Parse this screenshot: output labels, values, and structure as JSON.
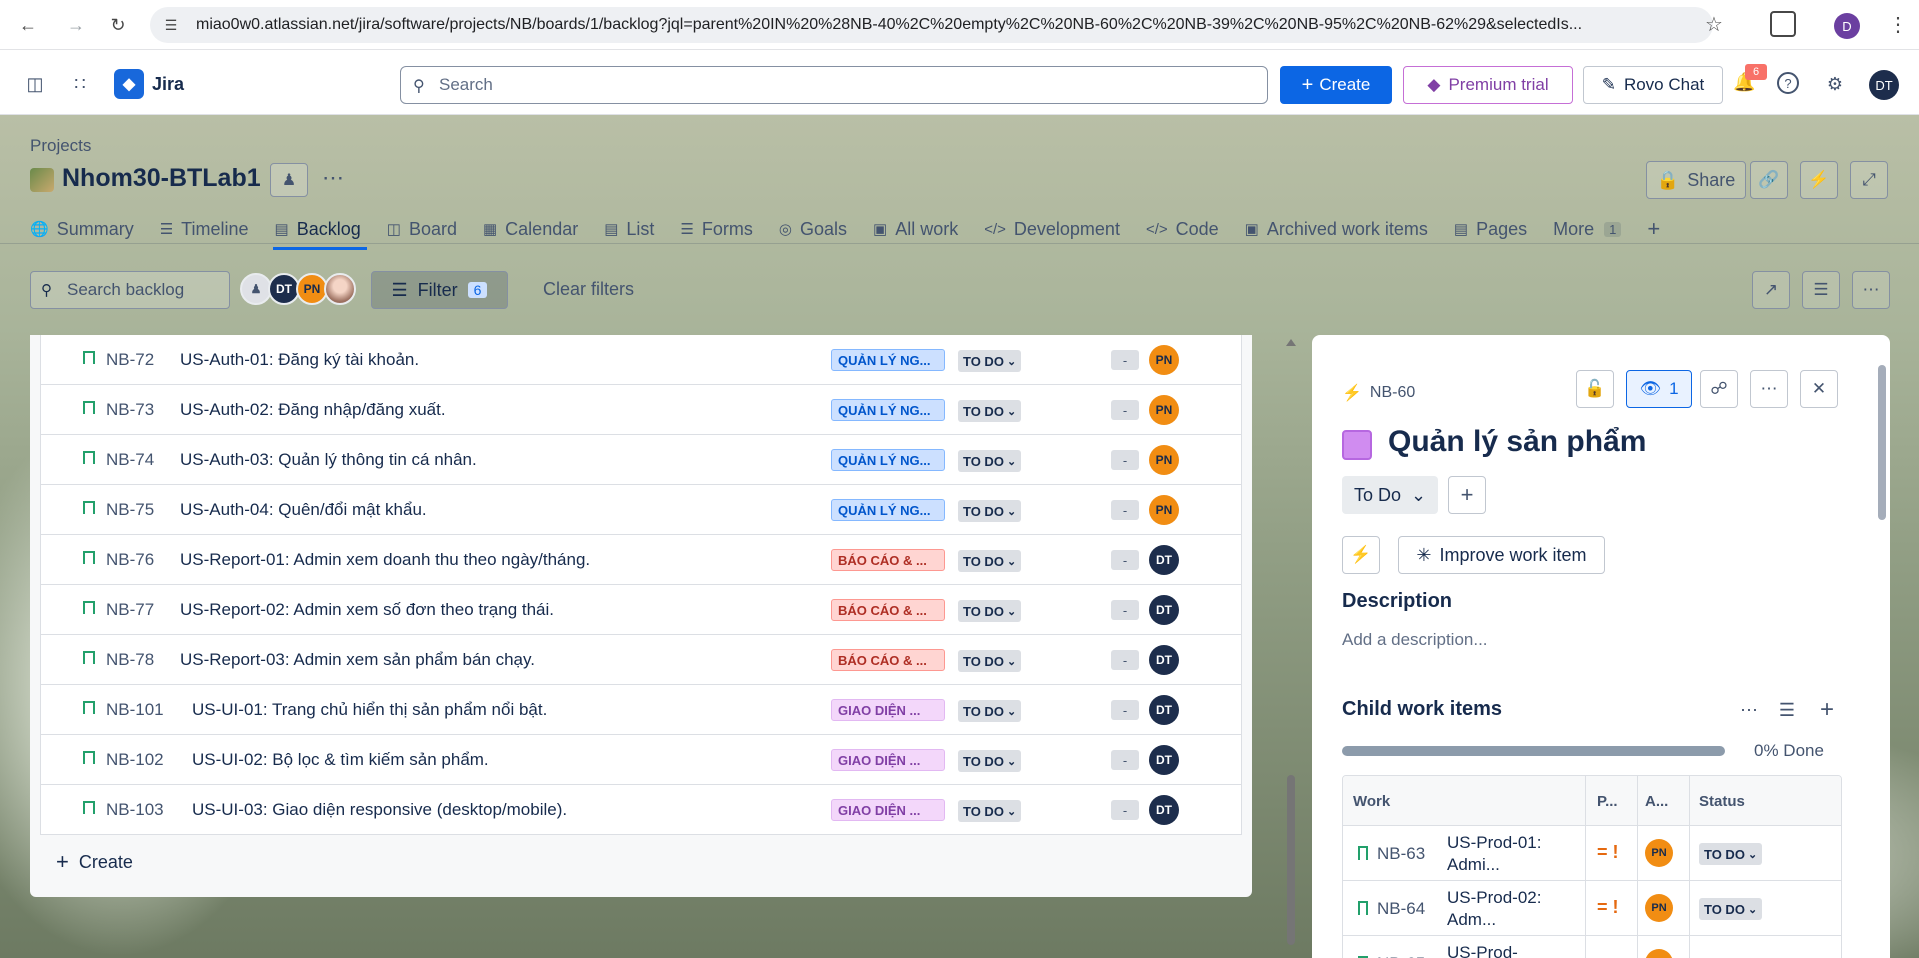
{
  "browser": {
    "url": "miao0w0.atlassian.net/jira/software/projects/NB/boards/1/backlog?jql=parent%20IN%20%28NB-40%2C%20empty%2C%20NB-60%2C%20NB-39%2C%20NB-95%2C%20NB-62%29&selectedIs...",
    "profile_initial": "D"
  },
  "topnav": {
    "app_name": "Jira",
    "search_placeholder": "Search",
    "create_label": "Create",
    "premium_label": "Premium trial",
    "rovo_label": "Rovo Chat",
    "notifications_count": "6",
    "user_initials": "DT"
  },
  "project": {
    "breadcrumb": "Projects",
    "name": "Nhom30-BTLab1",
    "share_label": "Share",
    "tabs": [
      {
        "label": "Summary",
        "icon": "globe-icon"
      },
      {
        "label": "Timeline",
        "icon": "timeline-icon"
      },
      {
        "label": "Backlog",
        "icon": "backlog-icon"
      },
      {
        "label": "Board",
        "icon": "board-icon"
      },
      {
        "label": "Calendar",
        "icon": "calendar-icon"
      },
      {
        "label": "List",
        "icon": "list-icon"
      },
      {
        "label": "Forms",
        "icon": "forms-icon"
      },
      {
        "label": "Goals",
        "icon": "goals-icon"
      },
      {
        "label": "All work",
        "icon": "all-work-icon"
      },
      {
        "label": "Development",
        "icon": "development-icon"
      },
      {
        "label": "Code",
        "icon": "code-icon"
      },
      {
        "label": "Archived work items",
        "icon": "archive-icon"
      },
      {
        "label": "Pages",
        "icon": "pages-icon"
      }
    ],
    "more_label": "More",
    "more_count": "1"
  },
  "toolbar": {
    "search_placeholder": "Search backlog",
    "avatars": [
      "DT",
      "PN"
    ],
    "filter_label": "Filter",
    "filter_count": "6",
    "clear_filters_label": "Clear filters"
  },
  "backlog": {
    "rows": [
      {
        "key": "NB-72",
        "summary": "US-Auth-01: Đăng ký tài khoản.",
        "epic": "QUẢN LÝ NG...",
        "epic_color": "blue",
        "status": "TO DO",
        "estimate": "-",
        "assignee": "PN"
      },
      {
        "key": "NB-73",
        "summary": "US-Auth-02: Đăng nhập/đăng xuất.",
        "epic": "QUẢN LÝ NG...",
        "epic_color": "blue",
        "status": "TO DO",
        "estimate": "-",
        "assignee": "PN"
      },
      {
        "key": "NB-74",
        "summary": "US-Auth-03: Quản lý thông tin cá nhân.",
        "epic": "QUẢN LÝ NG...",
        "epic_color": "blue",
        "status": "TO DO",
        "estimate": "-",
        "assignee": "PN"
      },
      {
        "key": "NB-75",
        "summary": "US-Auth-04: Quên/đổi mật khẩu.",
        "epic": "QUẢN LÝ NG...",
        "epic_color": "blue",
        "status": "TO DO",
        "estimate": "-",
        "assignee": "PN"
      },
      {
        "key": "NB-76",
        "summary": "US-Report-01: Admin xem doanh thu theo ngày/tháng.",
        "epic": "BÁO CÁO & ...",
        "epic_color": "red",
        "status": "TO DO",
        "estimate": "-",
        "assignee": "DT"
      },
      {
        "key": "NB-77",
        "summary": "US-Report-02: Admin xem số đơn theo trạng thái.",
        "epic": "BÁO CÁO & ...",
        "epic_color": "red",
        "status": "TO DO",
        "estimate": "-",
        "assignee": "DT"
      },
      {
        "key": "NB-78",
        "summary": "US-Report-03: Admin xem sản phẩm bán chạy.",
        "epic": "BÁO CÁO & ...",
        "epic_color": "red",
        "status": "TO DO",
        "estimate": "-",
        "assignee": "DT"
      },
      {
        "key": "NB-101",
        "summary": "US-UI-01: Trang chủ hiển thị sản phẩm nổi bật.",
        "epic": "GIAO DIỆN ...",
        "epic_color": "purple",
        "status": "TO DO",
        "estimate": "-",
        "assignee": "DT"
      },
      {
        "key": "NB-102",
        "summary": "US-UI-02: Bộ lọc & tìm kiếm sản phẩm.",
        "epic": "GIAO DIỆN ...",
        "epic_color": "purple",
        "status": "TO DO",
        "estimate": "-",
        "assignee": "DT"
      },
      {
        "key": "NB-103",
        "summary": "US-UI-03: Giao diện responsive (desktop/mobile).",
        "epic": "GIAO DIỆN ...",
        "epic_color": "purple",
        "status": "TO DO",
        "estimate": "-",
        "assignee": "DT"
      }
    ],
    "create_label": "Create"
  },
  "detail": {
    "key": "NB-60",
    "watchers": "1",
    "title": "Quản lý sản phẩm",
    "status": "To Do",
    "improve_label": "Improve work item",
    "description_heading": "Description",
    "description_placeholder": "Add a description...",
    "child_heading": "Child work items",
    "progress": 0,
    "progress_text": "0% Done",
    "child_columns": [
      "Work",
      "P...",
      "A...",
      "Status"
    ],
    "child_rows": [
      {
        "key": "NB-63",
        "summary": "US-Prod-01: Admi...",
        "priority": "= !",
        "assignee": "PN",
        "status": "TO DO"
      },
      {
        "key": "NB-64",
        "summary": "US-Prod-02: Adm...",
        "priority": "= !",
        "assignee": "PN",
        "status": "TO DO"
      },
      {
        "key": "NB-65",
        "summary": "US-Prod-",
        "priority": "",
        "assignee": "PN",
        "status": ""
      }
    ]
  },
  "colors": {
    "brand": "#0c66e4",
    "epic_blue": "#cce0ff",
    "epic_red": "#ffd5d2",
    "epic_purple": "#f3d7fa",
    "avatar_pn": "#f18d13",
    "avatar_dt": "#1d2d4c"
  }
}
